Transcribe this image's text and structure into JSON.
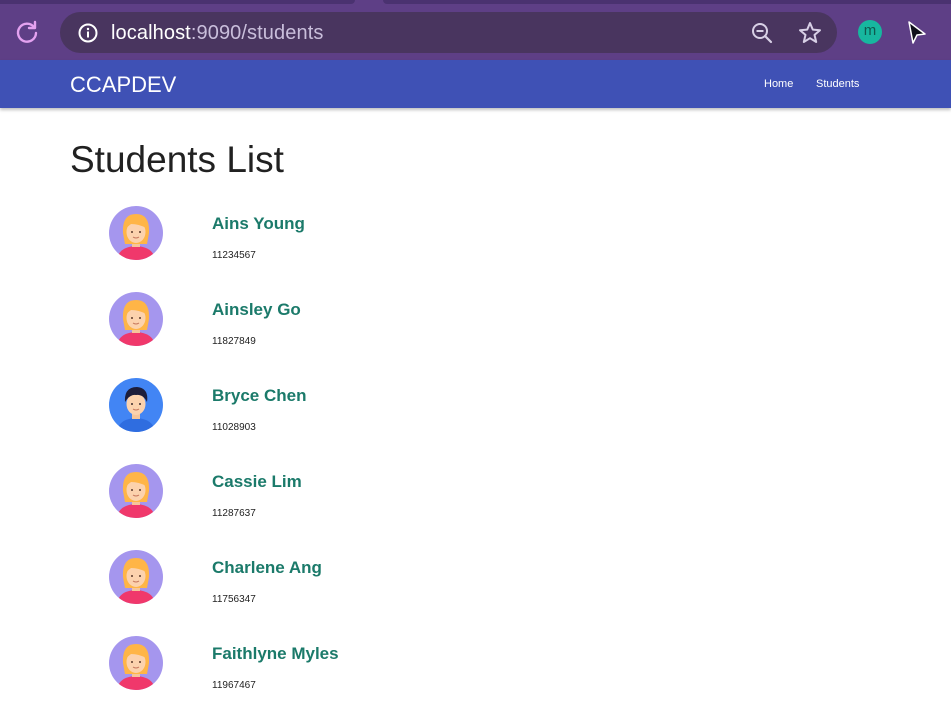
{
  "browser": {
    "url_host": "localhost",
    "url_rest": ":9090/students",
    "profile_initial": "m"
  },
  "navbar": {
    "brand": "CCAPDEV",
    "links": [
      {
        "label": "Home"
      },
      {
        "label": "Students"
      }
    ],
    "color": "#3f51b5"
  },
  "page": {
    "title": "Students List"
  },
  "students": [
    {
      "name": "Ains Young",
      "id": "11234567",
      "avatar": "female-avatar-icon"
    },
    {
      "name": "Ainsley Go",
      "id": "11827849",
      "avatar": "female-avatar-icon"
    },
    {
      "name": "Bryce Chen",
      "id": "11028903",
      "avatar": "male-avatar-icon"
    },
    {
      "name": "Cassie Lim",
      "id": "11287637",
      "avatar": "female-avatar-icon"
    },
    {
      "name": "Charlene Ang",
      "id": "11756347",
      "avatar": "female-avatar-icon"
    },
    {
      "name": "Faithlyne Myles",
      "id": "11967467",
      "avatar": "female-avatar-icon"
    }
  ],
  "colors": {
    "name_link": "#1b7a6a",
    "female_avatar_bg": "#a596ee",
    "male_avatar_bg": "#4285f4"
  }
}
